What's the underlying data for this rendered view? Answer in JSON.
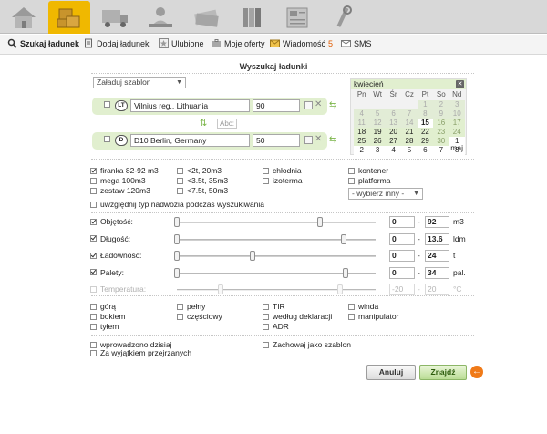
{
  "topnav": {
    "tabs": [
      {
        "icon": "home-icon"
      },
      {
        "icon": "cargo-boxes-icon"
      },
      {
        "icon": "truck-icon"
      },
      {
        "icon": "person-desk-icon"
      },
      {
        "icon": "money-icon"
      },
      {
        "icon": "books-icon"
      },
      {
        "icon": "newspaper-icon"
      },
      {
        "icon": "tools-icon"
      }
    ]
  },
  "menu": {
    "items": [
      {
        "label": "Szukaj ładunek",
        "icon": "search-icon"
      },
      {
        "label": "Dodaj ładunek",
        "icon": "add-document-icon"
      },
      {
        "label": "Ulubione",
        "icon": "star-icon"
      },
      {
        "label": "Moje oferty",
        "icon": "briefcase-icon"
      },
      {
        "label": "Wiadomość",
        "icon": "envelope-icon",
        "count": "5"
      },
      {
        "label": "SMS",
        "icon": "sms-icon"
      }
    ]
  },
  "page": {
    "title": "Wyszukaj ładunki"
  },
  "template_select": "Załaduj szablon",
  "origin": {
    "country": "LT",
    "value": "Vilnius reg., Lithuania",
    "radius": "90"
  },
  "destination": {
    "country": "D",
    "value": "D10 Berlin, Germany",
    "radius": "50"
  },
  "swap": {
    "arrows": "⇅",
    "abc_label": "Abc:"
  },
  "calendar": {
    "month": "kwiecień",
    "weekdays": [
      "Pn",
      "Wt",
      "Śr",
      "Cz",
      "Pt",
      "So",
      "Nd"
    ],
    "weeks": [
      [
        "",
        "",
        "",
        "",
        "1",
        "2",
        "3"
      ],
      [
        "4",
        "5",
        "6",
        "7",
        "8",
        "9",
        "10"
      ],
      [
        "11",
        "12",
        "13",
        "14",
        "15",
        "16",
        "17"
      ],
      [
        "18",
        "19",
        "20",
        "21",
        "22",
        "23",
        "24"
      ],
      [
        "25",
        "26",
        "27",
        "28",
        "29",
        "30",
        "1"
      ],
      [
        "2",
        "3",
        "4",
        "5",
        "6",
        "7",
        "8"
      ]
    ],
    "today": "15",
    "next_month": "maj"
  },
  "vehicle_types": {
    "col1": [
      {
        "label": "firanka 82-92 m3",
        "checked": true
      },
      {
        "label": "mega 100m3",
        "checked": false
      },
      {
        "label": "zestaw 120m3",
        "checked": false
      }
    ],
    "col2": [
      {
        "label": "<2t, 20m3",
        "checked": false
      },
      {
        "label": "<3.5t, 35m3",
        "checked": false
      },
      {
        "label": "<7.5t, 50m3",
        "checked": false
      }
    ],
    "col3": [
      {
        "label": "chłodnia",
        "checked": false
      },
      {
        "label": "izoterma",
        "checked": false
      }
    ],
    "col4": [
      {
        "label": "kontener",
        "checked": false
      },
      {
        "label": "platforma",
        "checked": false
      }
    ],
    "other_select": "- wybierz inny -",
    "include_body": "uwzględnij typ nadwozia podczas wyszukiwania"
  },
  "sliders": [
    {
      "label": "Objętość:",
      "checked": true,
      "min": "0",
      "max": "92",
      "unit": "m3",
      "low_fraction": 0.0,
      "high_fraction": 0.72
    },
    {
      "label": "Długość:",
      "checked": true,
      "min": "0",
      "max": "13.6",
      "unit": "ldm",
      "low_fraction": 0.0,
      "high_fraction": 0.84
    },
    {
      "label": "Ładowność:",
      "checked": true,
      "min": "0",
      "max": "24",
      "unit": "t",
      "low_fraction": 0.0,
      "high_fraction": 0.38
    },
    {
      "label": "Palety:",
      "checked": true,
      "min": "0",
      "max": "34",
      "unit": "pal.",
      "low_fraction": 0.0,
      "high_fraction": 0.85
    },
    {
      "label": "Temperatura:",
      "checked": false,
      "min": "-20",
      "max": "20",
      "unit": "°C",
      "low_fraction": 0.22,
      "high_fraction": 0.82,
      "disabled": true
    }
  ],
  "loading": {
    "col1": [
      "górą",
      "bokiem",
      "tyłem"
    ],
    "col2": [
      "pełny",
      "częściowy"
    ],
    "col3": [
      "TIR",
      "według deklaracji",
      "ADR"
    ],
    "col4": [
      "winda",
      "manipulator"
    ]
  },
  "extra": {
    "today_only": "wprowadzono dzisiaj",
    "except_viewed": "Za wyjątkiem przejrzanych",
    "save_template": "Zachowaj jako szablon"
  },
  "buttons": {
    "cancel": "Anuluj",
    "search": "Znajdź",
    "go": "←"
  }
}
